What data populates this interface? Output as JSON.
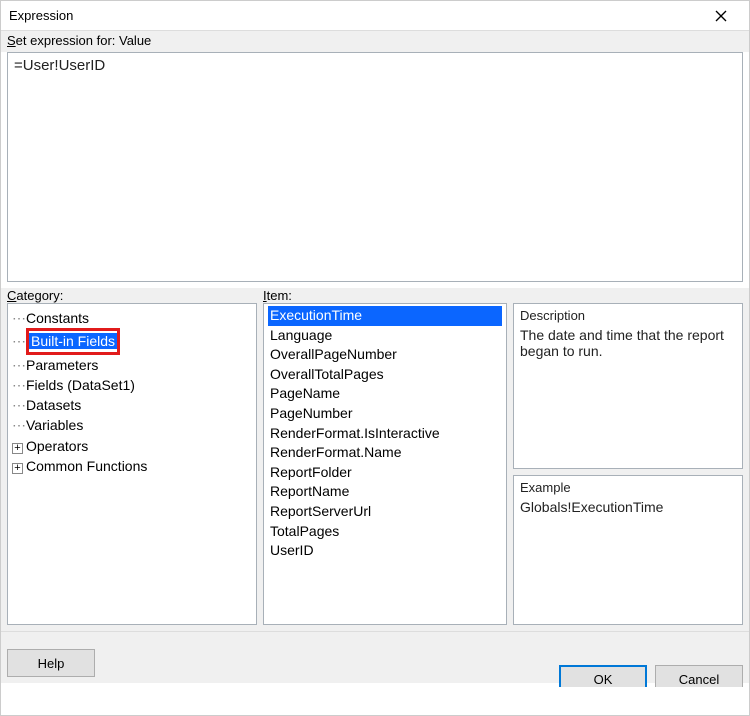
{
  "title": "Expression",
  "subhead_prefix": "S",
  "subhead_rest": "et expression for: Value",
  "expression": "=User!UserID",
  "labels": {
    "category_u": "C",
    "category_rest": "ategory:",
    "item_u": "I",
    "item_rest": "tem:"
  },
  "tree": [
    {
      "label": "Constants",
      "expandable": false
    },
    {
      "label": "Built-in Fields",
      "expandable": false,
      "selected": true,
      "boxed": true
    },
    {
      "label": "Parameters",
      "expandable": false
    },
    {
      "label": "Fields (DataSet1)",
      "expandable": false
    },
    {
      "label": "Datasets",
      "expandable": false
    },
    {
      "label": "Variables",
      "expandable": false
    },
    {
      "label": "Operators",
      "expandable": true
    },
    {
      "label": "Common Functions",
      "expandable": true
    }
  ],
  "items": [
    "ExecutionTime",
    "Language",
    "OverallPageNumber",
    "OverallTotalPages",
    "PageName",
    "PageNumber",
    "RenderFormat.IsInteractive",
    "RenderFormat.Name",
    "ReportFolder",
    "ReportName",
    "ReportServerUrl",
    "TotalPages",
    "UserID"
  ],
  "selected_item_index": 0,
  "description": {
    "title": "Description",
    "text": "The date and time that the report began to run."
  },
  "example": {
    "title": "Example",
    "text": "Globals!ExecutionTime"
  },
  "buttons": {
    "help": "Help",
    "ok": "OK",
    "cancel": "Cancel"
  }
}
